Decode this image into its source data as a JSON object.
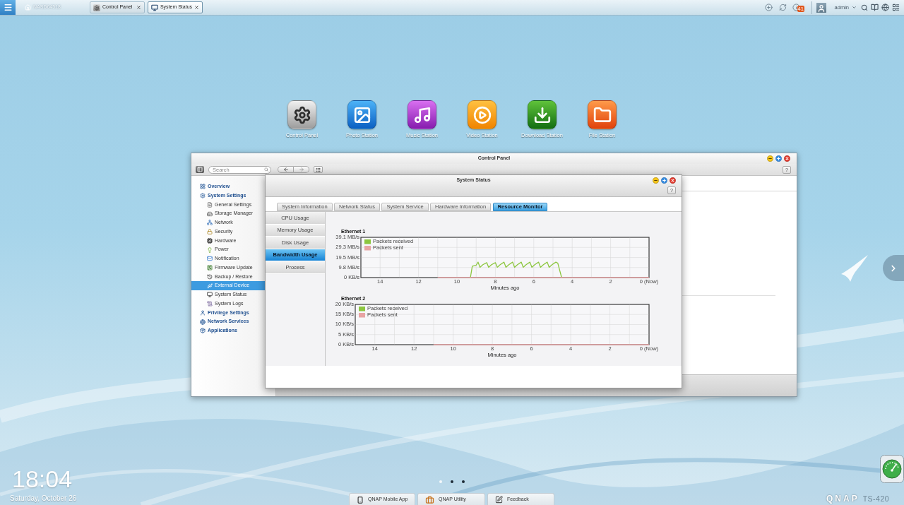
{
  "top_bar": {
    "home_label": "NASD64518",
    "tabs": [
      {
        "label": "Control Panel",
        "selected": false
      },
      {
        "label": "System Status",
        "selected": true
      }
    ],
    "notification_count": "41",
    "user": "admin"
  },
  "desktop_icons": [
    {
      "label": "Control Panel"
    },
    {
      "label": "Photo Station"
    },
    {
      "label": "Music Station"
    },
    {
      "label": "Video Station"
    },
    {
      "label": "Download Station"
    },
    {
      "label": "File Station"
    }
  ],
  "control_panel": {
    "title": "Control Panel",
    "search": {
      "placeholder": "Search"
    },
    "help": "?",
    "sidebar": [
      {
        "label": "Overview",
        "selected": false
      },
      {
        "label": "System Settings",
        "selected": false,
        "children": [
          {
            "label": "General Settings",
            "selected": false
          },
          {
            "label": "Storage Manager",
            "selected": false
          },
          {
            "label": "Network",
            "selected": false
          },
          {
            "label": "Security",
            "selected": false
          },
          {
            "label": "Hardware",
            "selected": false
          },
          {
            "label": "Power",
            "selected": false
          },
          {
            "label": "Notification",
            "selected": false
          },
          {
            "label": "Firmware Update",
            "selected": false
          },
          {
            "label": "Backup / Restore",
            "selected": false
          },
          {
            "label": "External Device",
            "selected": true
          },
          {
            "label": "System Status",
            "selected": false
          },
          {
            "label": "System Logs",
            "selected": false
          }
        ]
      },
      {
        "label": "Privilege Settings",
        "selected": false
      },
      {
        "label": "Network Services",
        "selected": false
      },
      {
        "label": "Applications",
        "selected": false
      }
    ]
  },
  "system_status": {
    "title": "System Status",
    "help": "?",
    "tabs": [
      {
        "label": "System Information",
        "selected": false
      },
      {
        "label": "Network Status",
        "selected": false
      },
      {
        "label": "System Service",
        "selected": false
      },
      {
        "label": "Hardware Information",
        "selected": false
      },
      {
        "label": "Resource Monitor",
        "selected": true
      }
    ],
    "menu": [
      {
        "label": "CPU Usage",
        "selected": false
      },
      {
        "label": "Memory Usage",
        "selected": false
      },
      {
        "label": "Disk Usage",
        "selected": false
      },
      {
        "label": "Bandwidth Usage",
        "selected": true
      },
      {
        "label": "Process",
        "selected": false
      }
    ],
    "charts": [
      {
        "chart_data": {
          "type": "line",
          "title": "Ethernet 1",
          "xlabel": "Minutes ago",
          "x": [
            11,
            9.3,
            9.2,
            9,
            8.9,
            8.8,
            8.65,
            8.45,
            8.35,
            8.2,
            8,
            7.9,
            7.75,
            7.55,
            7.45,
            7.3,
            7.1,
            7,
            6.85,
            6.65,
            6.55,
            6.4,
            6.2,
            6.1,
            5.95,
            5.75,
            5.65,
            5.5,
            5.3,
            5.2,
            5.05,
            4.85,
            4.75,
            4.55,
            0
          ],
          "series": [
            {
              "name": "Packets received",
              "color": "#8cc63f",
              "values": [
                null,
                0,
                11,
                12,
                15,
                10,
                12.5,
                14.5,
                10,
                12.5,
                14.5,
                10,
                12.5,
                15,
                10,
                12.5,
                15,
                10,
                12.5,
                15,
                10,
                12.5,
                15,
                10,
                12.5,
                15,
                10,
                12.5,
                15,
                10,
                12.5,
                15,
                14,
                0,
                null
              ]
            },
            {
              "name": "Packets sent",
              "color": "#e8a4a4",
              "values": [
                0,
                0,
                0,
                0,
                0,
                0,
                0,
                0,
                0,
                0,
                0,
                0,
                0,
                0,
                0,
                0,
                0,
                0,
                0,
                0,
                0,
                0,
                0,
                0,
                0,
                0,
                0,
                0,
                0,
                0,
                0,
                0,
                0,
                0,
                0
              ]
            }
          ],
          "xlim": [
            15,
            0
          ],
          "ylim": [
            0,
            39.1
          ],
          "xticks": [
            14,
            12,
            10,
            8,
            6,
            4,
            2,
            {
              "value": 0,
              "label": "0 (Now)"
            }
          ],
          "yticks": [
            {
              "value": 0,
              "label": "0 KB/s"
            },
            {
              "value": 9.8,
              "label": "9.8 MB/s"
            },
            {
              "value": 19.5,
              "label": "19.5 MB/s"
            },
            {
              "value": 29.3,
              "label": "29.3 MB/s"
            },
            {
              "value": 39.1,
              "label": "39.1 MB/s"
            }
          ],
          "grid": true,
          "legend": "upper left"
        }
      },
      {
        "chart_data": {
          "type": "line",
          "title": "Ethernet 2",
          "xlabel": "Minutes ago",
          "x": [
            11,
            0
          ],
          "series": [
            {
              "name": "Packets received",
              "color": "#8cc63f",
              "values": [
                null,
                null
              ]
            },
            {
              "name": "Packets sent",
              "color": "#e8a4a4",
              "values": [
                0,
                0
              ]
            }
          ],
          "xlim": [
            15,
            0
          ],
          "ylim": [
            0,
            20
          ],
          "xticks": [
            14,
            12,
            10,
            8,
            6,
            4,
            2,
            {
              "value": 0,
              "label": "0 (Now)"
            }
          ],
          "yticks": [
            {
              "value": 0,
              "label": "0 KB/s"
            },
            {
              "value": 5,
              "label": "5 KB/s"
            },
            {
              "value": 10,
              "label": "10 KB/s"
            },
            {
              "value": 15,
              "label": "15 KB/s"
            },
            {
              "value": 20,
              "label": "20 KB/s"
            }
          ],
          "grid": true,
          "legend": "upper left"
        }
      }
    ]
  },
  "page_dots": [
    {
      "selected": true
    },
    {
      "selected": false
    },
    {
      "selected": false
    }
  ],
  "clock": {
    "time": "18:04",
    "date": "Saturday, October 26"
  },
  "dock": [
    {
      "label": "QNAP Mobile App"
    },
    {
      "label": "QNAP Utility"
    },
    {
      "label": "Feedback"
    }
  ],
  "brand": {
    "logo": "QNAP",
    "model": "TS-420"
  }
}
